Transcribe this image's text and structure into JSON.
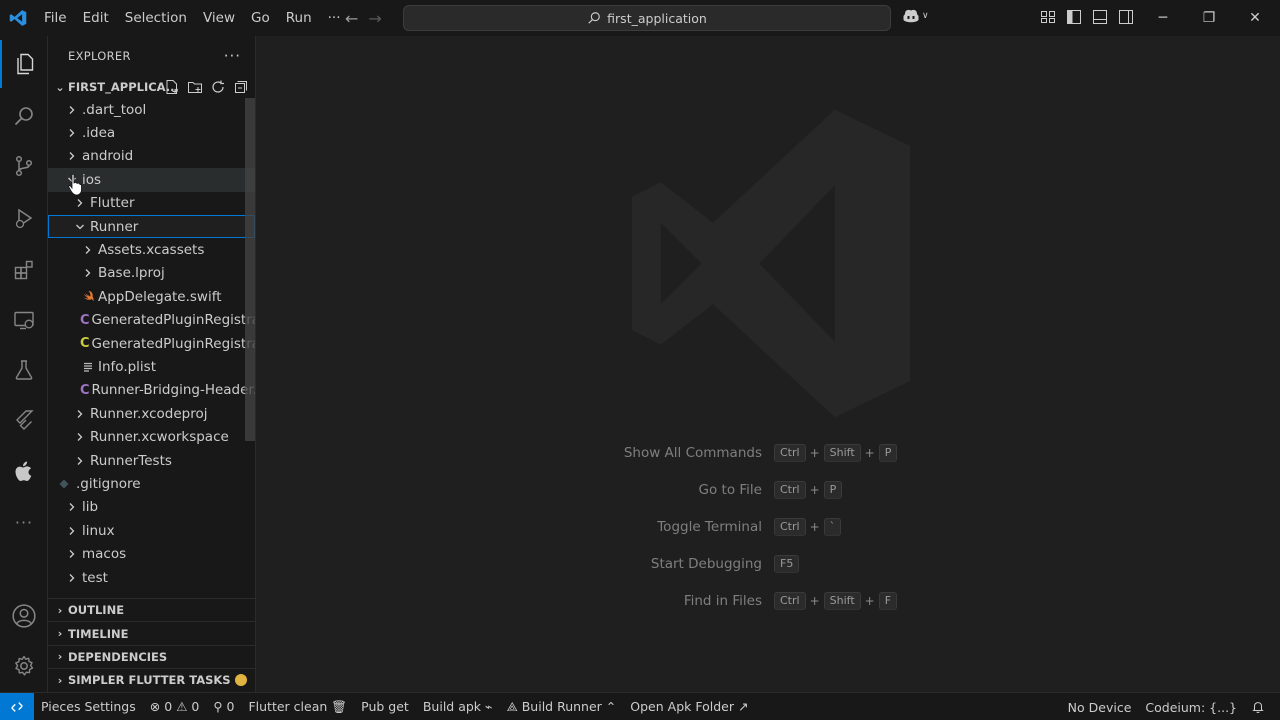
{
  "titlebar": {
    "menu": [
      "File",
      "Edit",
      "Selection",
      "View",
      "Go",
      "Run",
      "···"
    ],
    "search_text": "first_application"
  },
  "sidebar": {
    "title": "EXPLORER",
    "more": "···",
    "workspace": "FIRST_APPLICA...",
    "tree": [
      {
        "label": ".dart_tool",
        "type": "folder",
        "depth": 0,
        "expanded": false
      },
      {
        "label": ".idea",
        "type": "folder",
        "depth": 0,
        "expanded": false
      },
      {
        "label": "android",
        "type": "folder",
        "depth": 0,
        "expanded": false
      },
      {
        "label": "ios",
        "type": "folder",
        "depth": 0,
        "expanded": true
      },
      {
        "label": "Flutter",
        "type": "folder",
        "depth": 1,
        "expanded": false
      },
      {
        "label": "Runner",
        "type": "folder",
        "depth": 1,
        "expanded": true
      },
      {
        "label": "Assets.xcassets",
        "type": "folder",
        "depth": 2,
        "expanded": false
      },
      {
        "label": "Base.lproj",
        "type": "folder",
        "depth": 2,
        "expanded": false
      },
      {
        "label": "AppDelegate.swift",
        "type": "swift",
        "depth": 2
      },
      {
        "label": "GeneratedPluginRegistra...",
        "type": "c-purple",
        "depth": 2
      },
      {
        "label": "GeneratedPluginRegistra...",
        "type": "c-yellow",
        "depth": 2
      },
      {
        "label": "Info.plist",
        "type": "plist",
        "depth": 2
      },
      {
        "label": "Runner-Bridging-Header.h",
        "type": "c-purple",
        "depth": 2
      },
      {
        "label": "Runner.xcodeproj",
        "type": "folder",
        "depth": 1,
        "expanded": false
      },
      {
        "label": "Runner.xcworkspace",
        "type": "folder",
        "depth": 1,
        "expanded": false
      },
      {
        "label": "RunnerTests",
        "type": "folder",
        "depth": 1,
        "expanded": false
      },
      {
        "label": ".gitignore",
        "type": "gitignore",
        "depth": 1
      },
      {
        "label": "lib",
        "type": "folder",
        "depth": 0,
        "expanded": false
      },
      {
        "label": "linux",
        "type": "folder",
        "depth": 0,
        "expanded": false
      },
      {
        "label": "macos",
        "type": "folder",
        "depth": 0,
        "expanded": false
      },
      {
        "label": "test",
        "type": "folder",
        "depth": 0,
        "expanded": false
      }
    ],
    "sections": [
      "OUTLINE",
      "TIMELINE",
      "DEPENDENCIES",
      "SIMPLER FLUTTER TASKS"
    ]
  },
  "welcome": {
    "shortcuts": [
      {
        "label": "Show All Commands",
        "keys": [
          "Ctrl",
          "Shift",
          "P"
        ]
      },
      {
        "label": "Go to File",
        "keys": [
          "Ctrl",
          "P"
        ]
      },
      {
        "label": "Toggle Terminal",
        "keys": [
          "Ctrl",
          "`"
        ]
      },
      {
        "label": "Start Debugging",
        "keys": [
          "F5"
        ]
      },
      {
        "label": "Find in Files",
        "keys": [
          "Ctrl",
          "Shift",
          "F"
        ]
      }
    ]
  },
  "statusbar": {
    "pieces": "Pieces Settings",
    "errors": "0",
    "warnings": "0",
    "ports": "0",
    "flutter_clean": "Flutter clean",
    "pub_get": "Pub get",
    "build_apk": "Build apk",
    "build_runner": "Build Runner",
    "open_apk_folder": "Open Apk Folder",
    "device": "No Device",
    "codeium": "Codeium: {...}"
  },
  "colors": {
    "accent": "#0078d4",
    "c_purple": "#a074c4",
    "c_yellow": "#cbcb41",
    "swift": "#e37933"
  }
}
